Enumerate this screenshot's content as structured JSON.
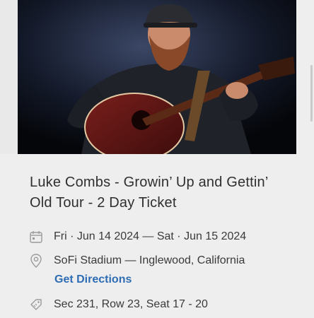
{
  "event": {
    "title_line1": "Luke Combs - Growin’ Up and Gettin’",
    "title_line2": "Old Tour - 2 Day Ticket",
    "date": "Fri · Jun 14 2024 — Sat · Jun 15 2024",
    "venue": "SoFi Stadium — Inglewood, California",
    "directions_label": "Get Directions",
    "seats": "Sec 231, Row 23, Seat 17 - 20"
  },
  "icons": {
    "date": "calendar-icon",
    "venue": "location-pin-icon",
    "seats": "ticket-tag-icon"
  },
  "colors": {
    "background": "#eeeeef",
    "link": "#2e6db4",
    "text": "#2f2f2f",
    "icon": "#9a9a9a"
  }
}
